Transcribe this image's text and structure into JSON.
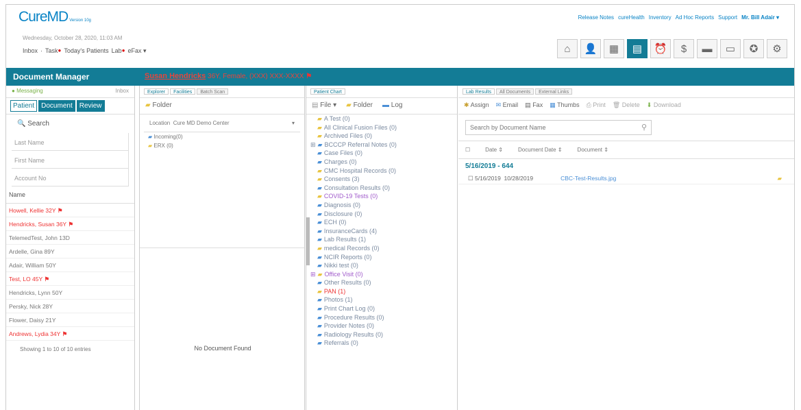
{
  "header": {
    "logo_main": "CureMD",
    "logo_version": "Version 10g",
    "links": [
      "Release Notes",
      "cureHealth",
      "Inventory",
      "Ad Hoc Reports",
      "Support"
    ],
    "user": "Mr. Bill Adair ▾"
  },
  "datetime": "Wednesday, October 28, 2020, 11:03 AM",
  "subnav": {
    "inbox": "Inbox",
    "task": "Task",
    "todays_patients": "Today's Patients",
    "lab": "Lab",
    "efax": "eFax"
  },
  "icons": [
    "home-icon",
    "patient-icon",
    "calendar-icon",
    "document-icon",
    "alarm-icon",
    "billing-icon",
    "reports-icon",
    "forms-icon",
    "gear-award-icon",
    "settings-icon"
  ],
  "title": "Document Manager",
  "patient_banner": {
    "name": "Susan Hendricks",
    "details": "36Y, Female, (XXX) XXX-XXXX"
  },
  "left": {
    "messaging": "Messaging",
    "inbox": "Inbox",
    "tabs": [
      "Patient",
      "Document",
      "Review"
    ],
    "search": "Search",
    "fields": [
      "Last Name",
      "First Name",
      "Account No"
    ],
    "name_header": "Name",
    "patients": [
      {
        "name": "Howell, Kellie 32Y",
        "red": true,
        "flag": true
      },
      {
        "name": "Hendricks, Susan 36Y",
        "red": true,
        "flag": true
      },
      {
        "name": "TelemedTest, John 13D",
        "red": false,
        "flag": false
      },
      {
        "name": "Ardelle, Gina 89Y",
        "red": false,
        "flag": false
      },
      {
        "name": "Adair, William 50Y",
        "red": false,
        "flag": false
      },
      {
        "name": "Test, LO 45Y",
        "red": true,
        "flag": true
      },
      {
        "name": "Hendricks, Lynn 50Y",
        "red": false,
        "flag": false
      },
      {
        "name": "Persky, Nick 28Y",
        "red": false,
        "flag": false
      },
      {
        "name": "Flower, Daisy 21Y",
        "red": false,
        "flag": false
      },
      {
        "name": "Andrews, Lydia 34Y",
        "red": true,
        "flag": true
      }
    ],
    "showing": "Showing 1 to 10 of 10 entries"
  },
  "explorer": {
    "tabs": [
      "Explorer",
      "Facilities",
      "Batch Scan"
    ],
    "folder_btn": "Folder",
    "location_label": "Location",
    "location_value": "Cure MD Demo Center",
    "folders": [
      "Incoming(0)",
      "ERX (0)"
    ],
    "empty": "No Document Found"
  },
  "chart": {
    "tab": "Patient Chart",
    "file_btn": "File ▾",
    "folder_btn": "Folder",
    "log_btn": "Log",
    "folders": [
      {
        "label": "A Test (0)",
        "color": "y"
      },
      {
        "label": "All Clinical Fusion Files (0)",
        "color": "y"
      },
      {
        "label": "Archived Files (0)",
        "color": "y"
      },
      {
        "label": "BCCCP Referral Notes (0)",
        "color": "b",
        "plus": true
      },
      {
        "label": "Case Files (0)",
        "color": "b"
      },
      {
        "label": "Charges (0)",
        "color": "b"
      },
      {
        "label": "CMC Hospital Records (0)",
        "color": "y"
      },
      {
        "label": "Consents (3)",
        "color": "y"
      },
      {
        "label": "Consultation Results (0)",
        "color": "b"
      },
      {
        "label": "COVID-19 Tests (0)",
        "color": "y",
        "style": "pur"
      },
      {
        "label": "Diagnosis (0)",
        "color": "b"
      },
      {
        "label": "Disclosure (0)",
        "color": "b"
      },
      {
        "label": "ECH (0)",
        "color": "b"
      },
      {
        "label": "InsuranceCards (4)",
        "color": "b"
      },
      {
        "label": "Lab Results (1)",
        "color": "b"
      },
      {
        "label": "medical Records (0)",
        "color": "y"
      },
      {
        "label": "NCIR Reports (0)",
        "color": "b"
      },
      {
        "label": "Nikki test (0)",
        "color": "b"
      },
      {
        "label": "Office Visit (0)",
        "color": "y",
        "style": "pur",
        "plus": true
      },
      {
        "label": "Other Results (0)",
        "color": "b"
      },
      {
        "label": "PAN (1)",
        "color": "y",
        "style": "red"
      },
      {
        "label": "Photos (1)",
        "color": "b"
      },
      {
        "label": "Print Chart Log (0)",
        "color": "b"
      },
      {
        "label": "Procedure Results (0)",
        "color": "b"
      },
      {
        "label": "Provider Notes (0)",
        "color": "b"
      },
      {
        "label": "Radiology Results (0)",
        "color": "b"
      },
      {
        "label": "Referrals (0)",
        "color": "b"
      }
    ]
  },
  "docs": {
    "tabs": [
      "Lab Results",
      "All Documents",
      "External Links"
    ],
    "actions": [
      "Assign",
      "Email",
      "Fax",
      "Thumbs",
      "Print",
      "Delete",
      "Download"
    ],
    "search_placeholder": "Search by Document Name",
    "col_headers": [
      "Date",
      "Document Date",
      "Document"
    ],
    "group": "5/16/2019 - 644",
    "rows": [
      {
        "date": "5/16/2019",
        "doc_date": "10/28/2019",
        "name": "CBC-Test-Results.jpg"
      }
    ]
  }
}
